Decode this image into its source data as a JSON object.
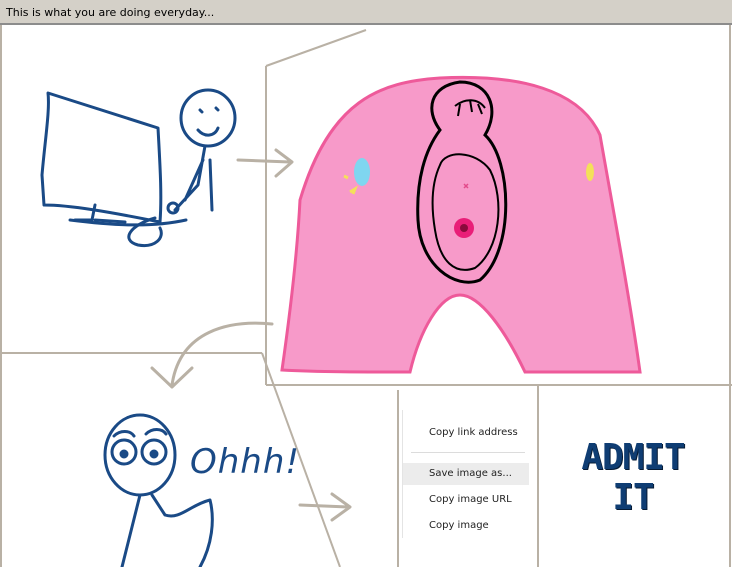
{
  "window": {
    "title": "This is what you are doing everyday..."
  },
  "panel_three": {
    "exclamation": "Ohhh!"
  },
  "context_menu": {
    "items": [
      {
        "label": "Copy link address",
        "highlighted": false
      },
      {
        "label": "Save image as...",
        "highlighted": true
      },
      {
        "label": "Copy image URL",
        "highlighted": false
      },
      {
        "label": "Copy image",
        "highlighted": false
      }
    ]
  },
  "panel_four": {
    "line1": "ADMIT",
    "line2": "IT"
  },
  "colors": {
    "ink": "#1a4a86",
    "pink": "#f79ac9",
    "pink_edge": "#ee5a9a",
    "frame": "#b9b1a5",
    "admit": "#0f3d73"
  },
  "icons": [
    "arrow-cursor-icon"
  ]
}
